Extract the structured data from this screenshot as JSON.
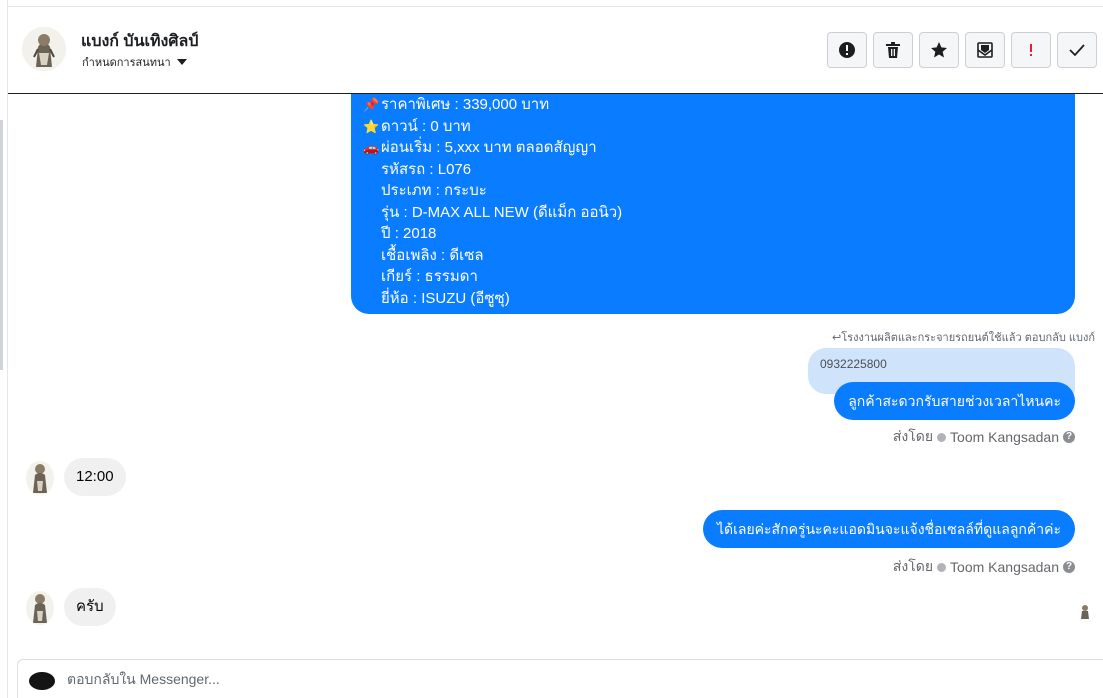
{
  "header": {
    "page_name": "แบงก์ บันเทิงศิลป์",
    "assign_label": "กำหนดการสนทนา"
  },
  "actions": [
    {
      "name": "alert-icon"
    },
    {
      "name": "trash-icon"
    },
    {
      "name": "star-icon"
    },
    {
      "name": "envelope-icon"
    },
    {
      "name": "exclamation-icon"
    },
    {
      "name": "check-icon"
    }
  ],
  "colors": {
    "accent": "#0a7cff",
    "bubble_grey": "#f0f0f0",
    "quote_bg": "#cfe4fb",
    "exclamation": "#e41e3f"
  },
  "listing": {
    "price": "ราคาพิเศษ : 339,000 บาท",
    "down": "ดาวน์ : 0 บาท",
    "installment": "ผ่อนเริ่ม : 5,xxx บาท ตลอดสัญญา",
    "code": "รหัสรถ : L076",
    "type": "ประเภท : กระบะ",
    "model": "รุ่น : D-MAX ALL NEW (ดีแม็ก ออนิว)",
    "year": "ปี : 2018",
    "fuel": "เชื้อเพลิง : ดีเซล",
    "gear": "เกียร์ : ธรรมดา",
    "brand": "ยี่ห้อ : ISUZU (อีซูซุ)"
  },
  "reply_note": "โรงงานผลิตและกระจายรถยนต์ใช้แล้ว ตอบกลับ แบงก์",
  "quoted_text": "0932225800",
  "messages": {
    "out1": "ลูกค้าสะดวกรับสายช่วงเวลาไหนคะ",
    "in1": "12:00",
    "out2": "ได้เลยค่ะสักครู่นะคะแอดมินจะแจ้งชื่อเซลล์ที่ดูแลลูกค้าค่ะ",
    "in2": "ครับ"
  },
  "sent_by": {
    "label": "ส่งโดย",
    "name": "Toom Kangsadan",
    "help": "?"
  },
  "composer": {
    "placeholder": "ตอบกลับใน Messenger..."
  }
}
